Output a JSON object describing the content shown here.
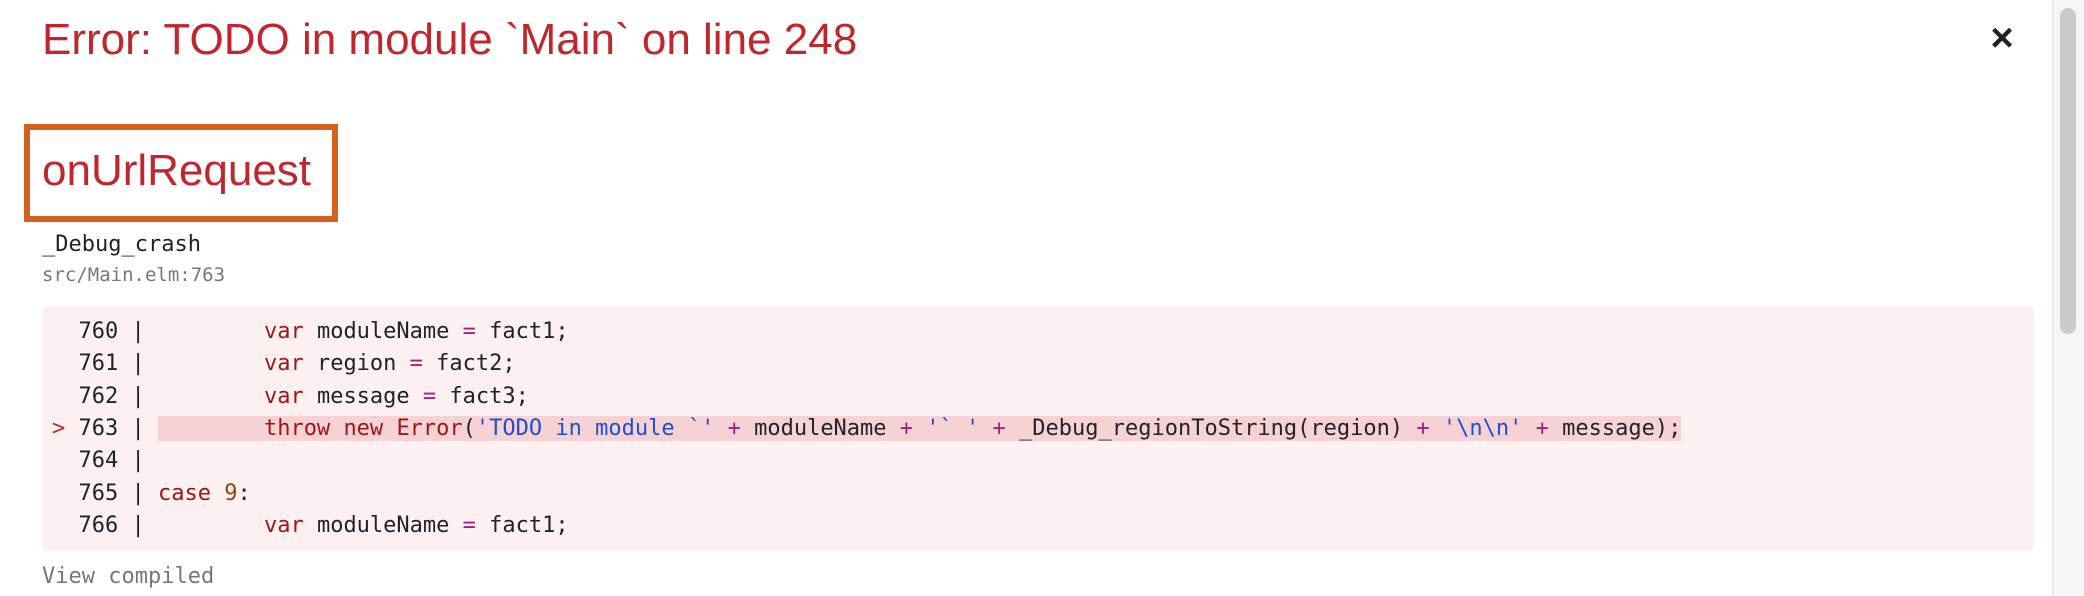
{
  "error": {
    "title": "Error: TODO in module `Main` on line 248",
    "close_glyph": "×"
  },
  "frame": {
    "function_name": "onUrlRequest",
    "internal_name": "_Debug_crash",
    "source": "src/Main.elm:763"
  },
  "code": {
    "highlighted_line": 763,
    "lines": [
      {
        "marker": "  ",
        "number": "760",
        "sep": " | ",
        "tokens": [
          {
            "t": "        ",
            "c": "ident"
          },
          {
            "t": "var",
            "c": "kw"
          },
          {
            "t": " moduleName ",
            "c": "ident"
          },
          {
            "t": "=",
            "c": "op"
          },
          {
            "t": " fact1;",
            "c": "ident"
          }
        ]
      },
      {
        "marker": "  ",
        "number": "761",
        "sep": " | ",
        "tokens": [
          {
            "t": "        ",
            "c": "ident"
          },
          {
            "t": "var",
            "c": "kw"
          },
          {
            "t": " region ",
            "c": "ident"
          },
          {
            "t": "=",
            "c": "op"
          },
          {
            "t": " fact2;",
            "c": "ident"
          }
        ]
      },
      {
        "marker": "  ",
        "number": "762",
        "sep": " | ",
        "tokens": [
          {
            "t": "        ",
            "c": "ident"
          },
          {
            "t": "var",
            "c": "kw"
          },
          {
            "t": " message ",
            "c": "ident"
          },
          {
            "t": "=",
            "c": "op"
          },
          {
            "t": " fact3;",
            "c": "ident"
          }
        ]
      },
      {
        "marker": "> ",
        "number": "763",
        "sep": " | ",
        "tokens": [
          {
            "t": "        ",
            "c": "ident"
          },
          {
            "t": "throw",
            "c": "kw"
          },
          {
            "t": " ",
            "c": "ident"
          },
          {
            "t": "new",
            "c": "kw"
          },
          {
            "t": " ",
            "c": "ident"
          },
          {
            "t": "Error",
            "c": "kw"
          },
          {
            "t": "(",
            "c": "ident"
          },
          {
            "t": "'TODO in module `'",
            "c": "str"
          },
          {
            "t": " ",
            "c": "ident"
          },
          {
            "t": "+",
            "c": "op"
          },
          {
            "t": " moduleName ",
            "c": "ident"
          },
          {
            "t": "+",
            "c": "op"
          },
          {
            "t": " ",
            "c": "ident"
          },
          {
            "t": "'` '",
            "c": "str"
          },
          {
            "t": " ",
            "c": "ident"
          },
          {
            "t": "+",
            "c": "op"
          },
          {
            "t": " _Debug_regionToString(region) ",
            "c": "ident"
          },
          {
            "t": "+",
            "c": "op"
          },
          {
            "t": " ",
            "c": "ident"
          },
          {
            "t": "'\\n\\n'",
            "c": "str"
          },
          {
            "t": " ",
            "c": "ident"
          },
          {
            "t": "+",
            "c": "op"
          },
          {
            "t": " message);",
            "c": "ident"
          }
        ]
      },
      {
        "marker": "  ",
        "number": "764",
        "sep": " |",
        "tokens": []
      },
      {
        "marker": "  ",
        "number": "765",
        "sep": " | ",
        "tokens": [
          {
            "t": "case",
            "c": "kw"
          },
          {
            "t": " ",
            "c": "ident"
          },
          {
            "t": "9",
            "c": "num"
          },
          {
            "t": ":",
            "c": "ident"
          }
        ]
      },
      {
        "marker": "  ",
        "number": "766",
        "sep": " | ",
        "tokens": [
          {
            "t": "        ",
            "c": "ident"
          },
          {
            "t": "var",
            "c": "kw"
          },
          {
            "t": " moduleName ",
            "c": "ident"
          },
          {
            "t": "=",
            "c": "op"
          },
          {
            "t": " fact1;",
            "c": "ident"
          }
        ]
      }
    ]
  },
  "footer": {
    "view_compiled": "View compiled"
  }
}
